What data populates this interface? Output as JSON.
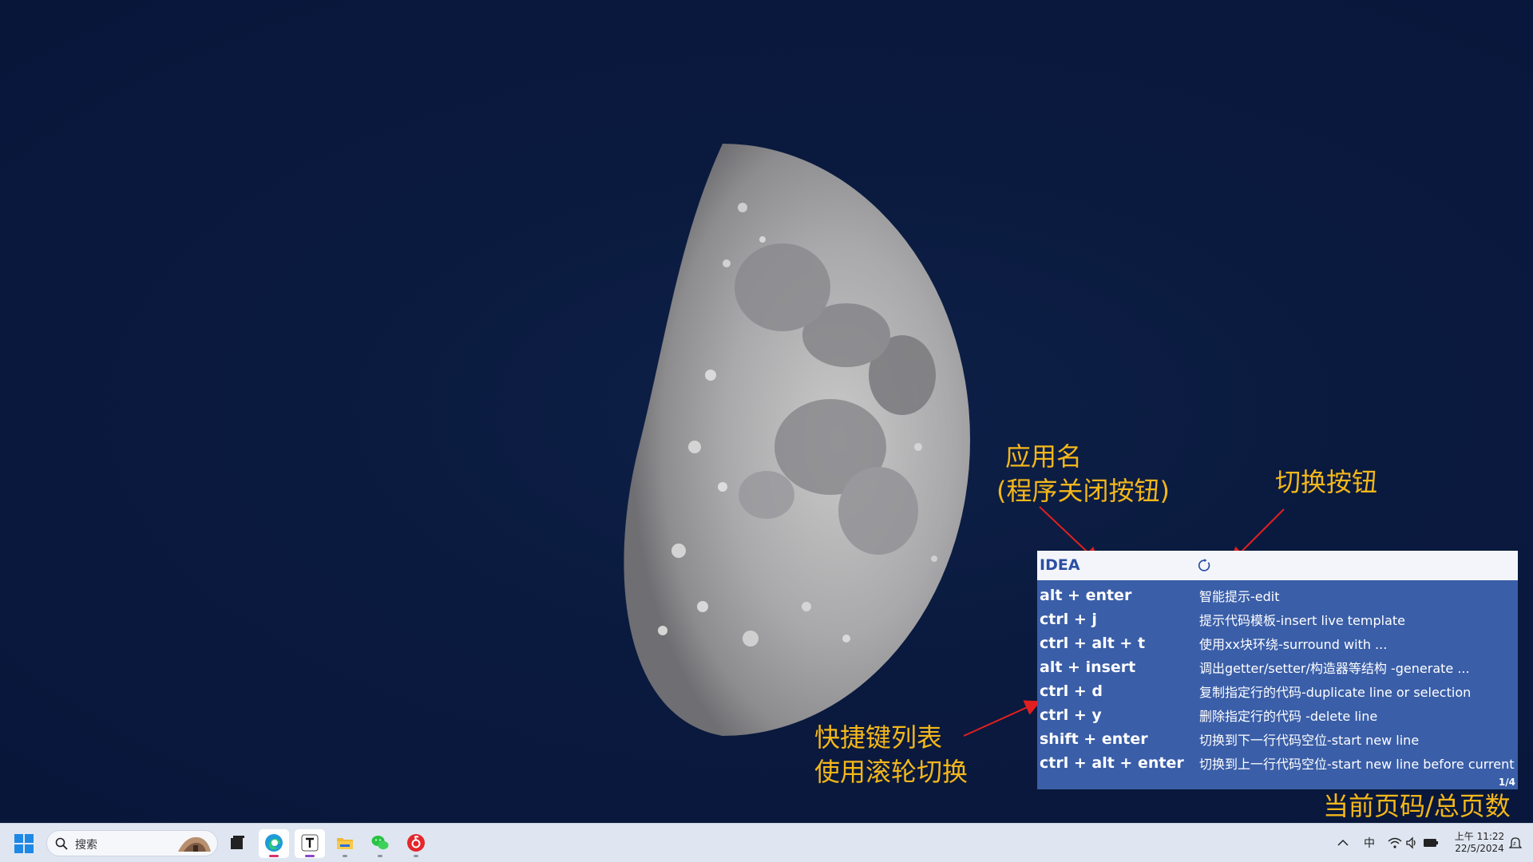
{
  "annotations": {
    "app_name_line1": "应用名",
    "app_name_line2": "(程序关闭按钮)",
    "toggle_button": "切换按钮",
    "shortcut_list_line1": "快捷键列表",
    "shortcut_list_line2": "使用滚轮切换",
    "page_indicator": "当前页码/总页数"
  },
  "panel": {
    "app_name": "IDEA",
    "page": "1/4",
    "rows": [
      {
        "keys": "alt + enter",
        "desc": "智能提示-edit"
      },
      {
        "keys": "ctrl + j",
        "desc": "提示代码模板-insert live template"
      },
      {
        "keys": "ctrl + alt + t",
        "desc": "使用xx块环绕-surround with ..."
      },
      {
        "keys": "alt + insert",
        "desc": "调出getter/setter/构造器等结构 -generate ..."
      },
      {
        "keys": "ctrl + d",
        "desc": "复制指定行的代码-duplicate line or selection"
      },
      {
        "keys": "ctrl + y",
        "desc": "删除指定行的代码  -delete line"
      },
      {
        "keys": "shift + enter",
        "desc": "切换到下一行代码空位-start new line"
      },
      {
        "keys": "ctrl + alt + enter",
        "desc": "切换到上一行代码空位-start new line before current"
      }
    ]
  },
  "taskbar": {
    "search_placeholder": "搜索",
    "ime": "中",
    "time": "上午 11:22",
    "date": "22/5/2024"
  },
  "colors": {
    "annotation": "#f4b71a",
    "panel_bg": "#3a5ea8",
    "panel_header": "#f3f5fa",
    "arrow": "#e02020"
  }
}
